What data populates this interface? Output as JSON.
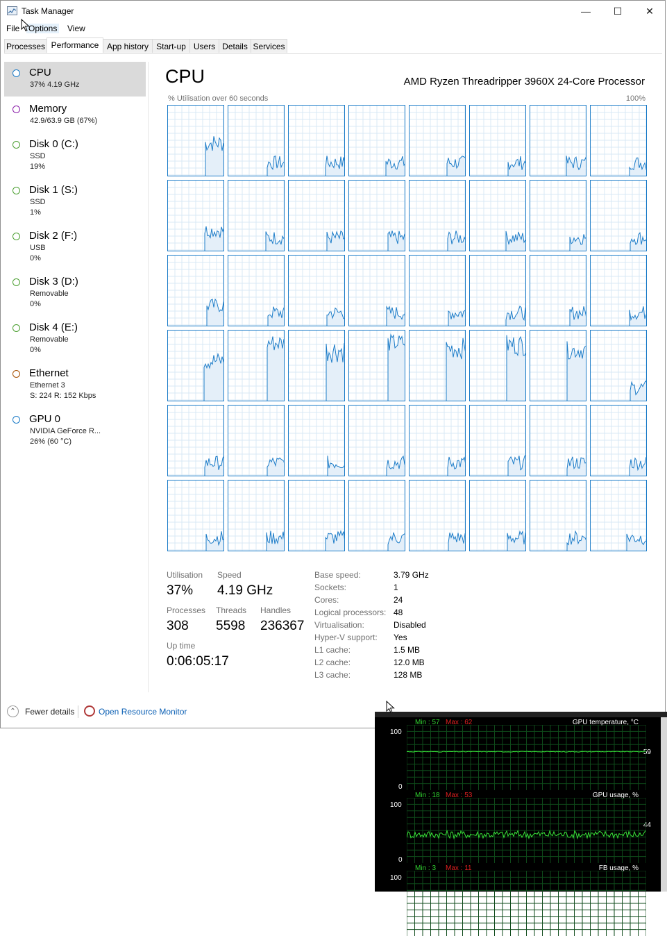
{
  "window": {
    "title": "Task Manager",
    "minimize": "—",
    "maximize": "☐",
    "close": "✕"
  },
  "menu": [
    "File",
    "Options",
    "View"
  ],
  "tabs": [
    "Processes",
    "Performance",
    "App history",
    "Start-up",
    "Users",
    "Details",
    "Services"
  ],
  "active_tab": "Performance",
  "sidebar": [
    {
      "title": "CPU",
      "lines": [
        "37%  4.19 GHz"
      ],
      "color": "#1c7cc8"
    },
    {
      "title": "Memory",
      "lines": [
        "42.9/63.9 GB (67%)"
      ],
      "color": "#8b1fa9"
    },
    {
      "title": "Disk 0 (C:)",
      "lines": [
        "SSD",
        "19%"
      ],
      "color": "#4da033"
    },
    {
      "title": "Disk 1 (S:)",
      "lines": [
        "SSD",
        "1%"
      ],
      "color": "#4da033"
    },
    {
      "title": "Disk 2 (F:)",
      "lines": [
        "USB",
        "0%"
      ],
      "color": "#4da033"
    },
    {
      "title": "Disk 3 (D:)",
      "lines": [
        "Removable",
        "0%"
      ],
      "color": "#4da033"
    },
    {
      "title": "Disk 4 (E:)",
      "lines": [
        "Removable",
        "0%"
      ],
      "color": "#4da033"
    },
    {
      "title": "Ethernet",
      "lines": [
        "Ethernet 3",
        "S: 224  R: 152 Kbps"
      ],
      "color": "#a74f01"
    },
    {
      "title": "GPU 0",
      "lines": [
        "NVIDIA GeForce R...",
        "26% (60 °C)"
      ],
      "color": "#1c7cc8"
    }
  ],
  "main": {
    "title": "CPU",
    "model": "AMD Ryzen Threadripper 3960X 24-Core Processor",
    "graph_label": "% Utilisation over 60 seconds",
    "graph_max": "100%",
    "logical_processor_graphs": 48
  },
  "stats": {
    "utilisation_label": "Utilisation",
    "utilisation": "37%",
    "speed_label": "Speed",
    "speed": "4.19 GHz",
    "processes_label": "Processes",
    "processes": "308",
    "threads_label": "Threads",
    "threads": "5598",
    "handles_label": "Handles",
    "handles": "236367",
    "uptime_label": "Up time",
    "uptime": "0:06:05:17"
  },
  "specs": [
    {
      "label": "Base speed:",
      "value": "3.79 GHz"
    },
    {
      "label": "Sockets:",
      "value": "1"
    },
    {
      "label": "Cores:",
      "value": "24"
    },
    {
      "label": "Logical processors:",
      "value": "48"
    },
    {
      "label": "Virtualisation:",
      "value": "Disabled"
    },
    {
      "label": "Hyper-V support:",
      "value": "Yes"
    },
    {
      "label": "L1 cache:",
      "value": "1.5 MB"
    },
    {
      "label": "L2 cache:",
      "value": "12.0 MB"
    },
    {
      "label": "L3 cache:",
      "value": "128 MB"
    }
  ],
  "footer": {
    "fewer_details": "Fewer details",
    "resource_monitor": "Open Resource Monitor"
  },
  "gpu_monitor": {
    "panels": [
      {
        "min": "Min : 57",
        "max": "Max : 62",
        "title": "GPU temperature, °C",
        "ymax": "100",
        "ymin": "0",
        "current": "59",
        "level": 59,
        "noise": 0.6
      },
      {
        "min": "Min : 18",
        "max": "Max : 53",
        "title": "GPU usage, %",
        "ymax": "100",
        "ymin": "0",
        "current": "44",
        "level": 44,
        "noise": 6
      },
      {
        "min": "Min : 3",
        "max": "Max : 11",
        "title": "FB usage, %",
        "ymax": "100",
        "ymin": "",
        "current": "",
        "level": null,
        "noise": 0
      }
    ]
  },
  "colors": {
    "accent": "#1c7cc8",
    "graph_fill": "#e4eff9",
    "gpu_line": "#39e639",
    "gpu_grid": "#0e4a1a"
  }
}
